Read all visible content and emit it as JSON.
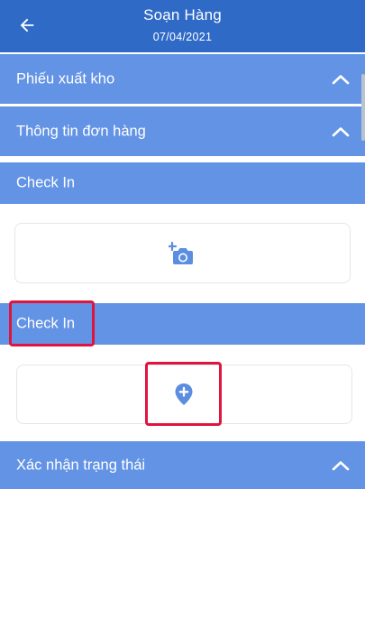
{
  "header": {
    "title": "Soạn Hàng",
    "date": "07/04/2021"
  },
  "sections": {
    "export_slip": {
      "label": "Phiếu xuất kho",
      "expanded": true
    },
    "order_info": {
      "label": "Thông tin đơn hàng",
      "expanded": true
    },
    "check_in_photo": {
      "label": "Check In"
    },
    "check_in_location": {
      "label": "Check In"
    },
    "status_confirm": {
      "label": "Xác nhận trạng thái",
      "expanded": true
    }
  },
  "icons": {
    "back": "back-arrow-icon",
    "chevron": "chevron-up-icon",
    "camera": "add-photo-icon",
    "location": "add-location-icon"
  },
  "colors": {
    "appbar": "#2f6ac6",
    "section": "#6393e4",
    "icon": "#5b8de0",
    "highlight": "#e0143c"
  }
}
